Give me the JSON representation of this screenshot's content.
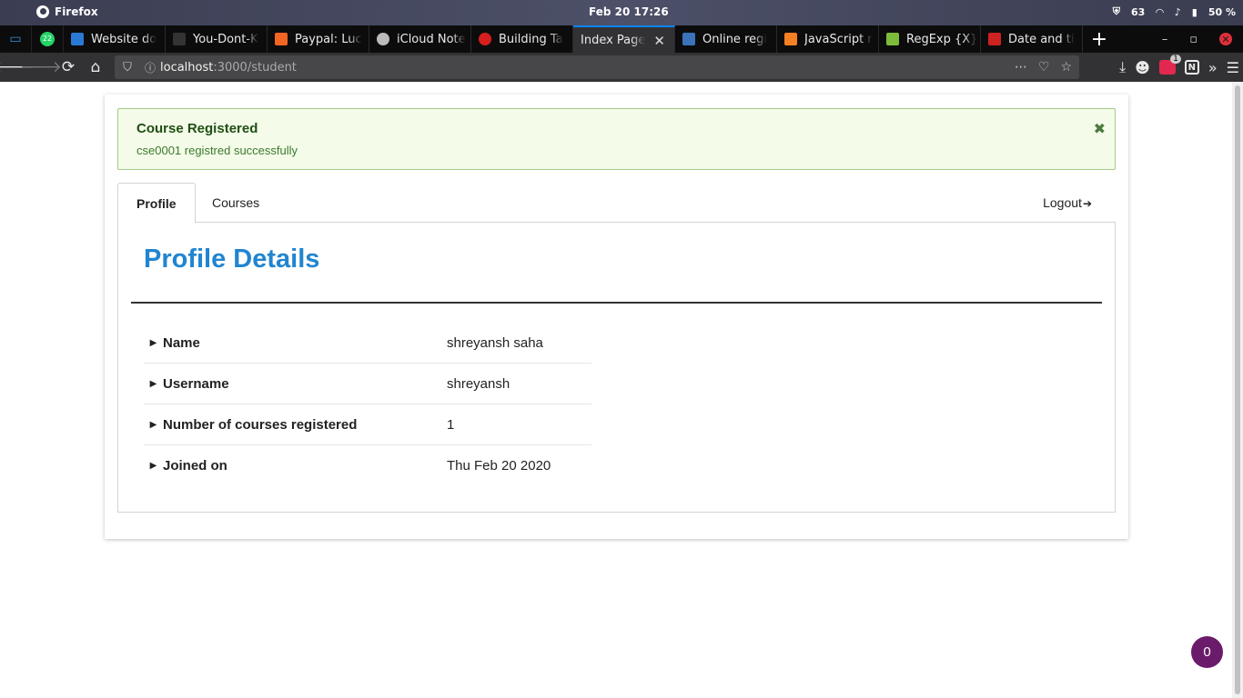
{
  "system": {
    "app_name": "Firefox",
    "clock": "Feb 20  17:26",
    "tray_count": "63",
    "battery": "50 %"
  },
  "tabs": [
    {
      "title": "Website do",
      "color": "#2a7ad5"
    },
    {
      "title": "You-Dont-K",
      "color": "#333333"
    },
    {
      "title": "Paypal: Luc",
      "color": "#f26522"
    },
    {
      "title": "iCloud Note",
      "color": "#bbbbbb"
    },
    {
      "title": "Building Ta",
      "color": "#d71e1e"
    },
    {
      "title": "Index Page",
      "color": "#323234"
    },
    {
      "title": "Online regi",
      "color": "#3b73b9"
    },
    {
      "title": "JavaScript r",
      "color": "#f48024"
    },
    {
      "title": "RegExp {X}",
      "color": "#7dbc3b"
    },
    {
      "title": "Date and ti",
      "color": "#cc2222"
    }
  ],
  "url": {
    "host": "localhost",
    "path": ":3000/student"
  },
  "alert": {
    "header": "Course Registered",
    "message": "cse0001 registred successfully",
    "close": "✖"
  },
  "nav": {
    "profile": "Profile",
    "courses": "Courses",
    "logout": "Logout"
  },
  "profile": {
    "title": "Profile Details",
    "rows": [
      {
        "label": "Name",
        "value": "shreyansh saha"
      },
      {
        "label": "Username",
        "value": "shreyansh"
      },
      {
        "label": "Number of courses registered",
        "value": "1"
      },
      {
        "label": "Joined on",
        "value": "Thu Feb 20 2020"
      }
    ]
  },
  "fab": {
    "count": "0"
  },
  "icons": {
    "close": "✖",
    "caret": "▶",
    "logout": "logout-icon"
  }
}
